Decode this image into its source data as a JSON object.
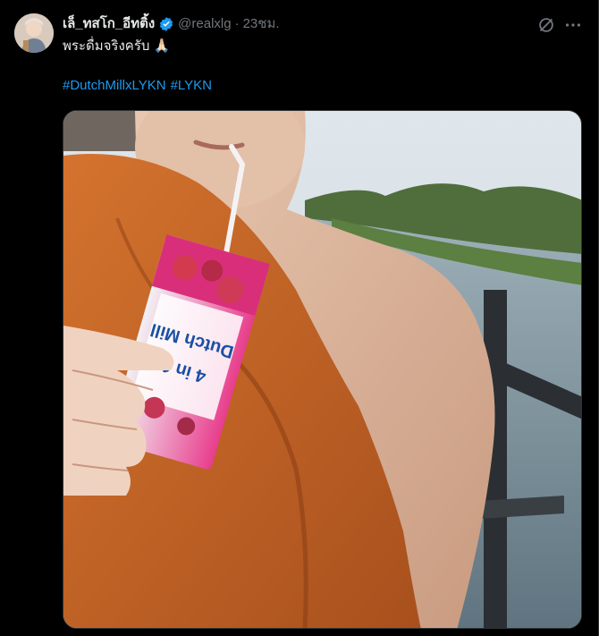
{
  "tweet": {
    "display_name": "เล็_ทสโก_อีทติ้ง",
    "handle": "@realxlg",
    "separator": "·",
    "time": "23ชม.",
    "text": "พระดื่มจริงครับ 🙏🏻",
    "hashtags": [
      "#DutchMillxLYKN",
      "#LYKN"
    ],
    "media": {
      "carton_brand": "Dutch Mill",
      "carton_label": "4 in 1"
    }
  },
  "icons": {
    "avatar": "avatar",
    "verified": "verified-badge-icon",
    "grok": "grok-icon",
    "more": "more-icon"
  },
  "colors": {
    "background": "#000000",
    "text": "#e7e9ea",
    "secondary_text": "#71767b",
    "link": "#1d9bf0",
    "verified": "#1d9bf0",
    "robe": "#c8662a"
  }
}
